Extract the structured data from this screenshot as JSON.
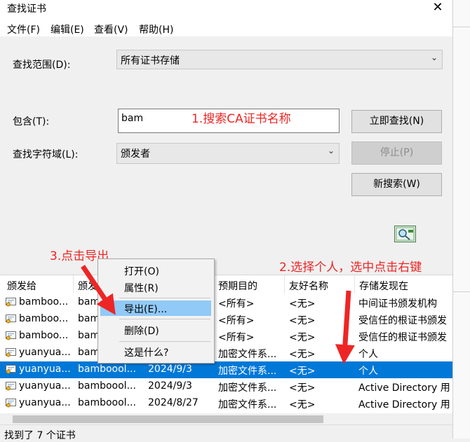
{
  "window": {
    "title": "查找证书",
    "close_glyph": "✕"
  },
  "menubar": [
    "文件(F)",
    "编辑(E)",
    "查看(V)",
    "帮助(H)"
  ],
  "form": {
    "scope_label": "查找范围(D):",
    "scope_value": "所有证书存储",
    "contains_label": "包含(T):",
    "contains_value": "bam",
    "field_label": "查找字符域(L):",
    "field_value": "颁发者",
    "find_now": "立即查找(N)",
    "stop": "停止(P)",
    "new_search": "新搜索(W)"
  },
  "annotations": {
    "step1": "1.搜索CA证书名称",
    "step2": "2.选择个人，选中点击右键",
    "step3": "3.点击导出"
  },
  "table": {
    "headers": [
      "颁发给",
      "颁发",
      "",
      "预期目的",
      "友好名称",
      "存储发现在"
    ],
    "rows": [
      [
        "bamboo...",
        "bam",
        "",
        "<所有>",
        "<无>",
        "中间证书颁发机构"
      ],
      [
        "bamboo...",
        "bam",
        "",
        "<所有>",
        "<无>",
        "受信任的根证书颁发"
      ],
      [
        "bamboo...",
        "bam",
        "",
        "<所有>",
        "<无>",
        "受信任的根证书颁发"
      ],
      [
        "yuanyua...",
        "bam",
        "",
        "加密文件系...",
        "<无>",
        "个人"
      ],
      [
        "yuanyua...",
        "bamboool...",
        "2024/9/3",
        "加密文件系...",
        "<无>",
        "个人"
      ],
      [
        "yuanyua...",
        "bamboool...",
        "2024/9/3",
        "加密文件系...",
        "<无>",
        "Active Directory 用"
      ],
      [
        "yuanyua...",
        "bamboool...",
        "2024/8/27",
        "加密文件系...",
        "<无>",
        "Active Directory 用"
      ]
    ],
    "selected_row": 4
  },
  "context_menu": {
    "items": [
      "打开(O)",
      "属性(R)",
      "导出(E)...",
      "删除(D)",
      "这是什么?"
    ],
    "highlighted": 2
  },
  "status": "找到了 7 个证书",
  "colors": {
    "selection": "#0078d7",
    "annotation": "#ee2525",
    "menu_highlight": "#91c9f7"
  }
}
